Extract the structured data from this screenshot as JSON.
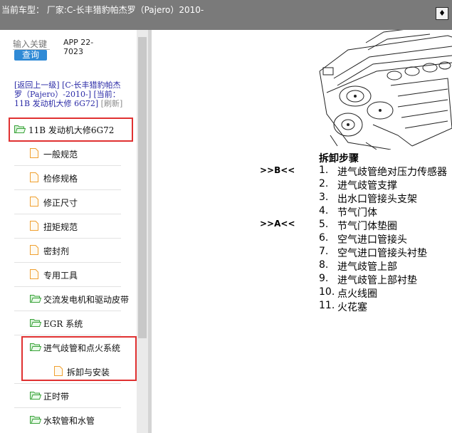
{
  "header": {
    "title": "当前车型： 厂家:C-长丰猎豹帕杰罗（Pajero）2010-",
    "close_glyph": "♦"
  },
  "search": {
    "placeholder": "输入关键",
    "button_label": "查询"
  },
  "app_id": "APP 22-7023",
  "breadcrumb": {
    "back_text": "[返回上一级] [C-长丰猎豹帕杰罗（Pajero）-2010-]",
    "current_text": "[当前：11B 发动机大修 6G72]",
    "refresh_text": "[刷新]"
  },
  "tree": {
    "root": "11B 发动机大修6G72",
    "items": [
      "一般规范",
      "检修规格",
      "修正尺寸",
      "扭矩规范",
      "密封剂",
      "专用工具",
      "交流发电机和驱动皮带",
      "EGR 系统",
      "进气歧管和点火系统",
      "拆卸与安装",
      "正时带",
      "水软管和水管"
    ]
  },
  "doc": {
    "steps_title": "拆卸步骤",
    "markers": [
      ">>B<<",
      ">>A<<"
    ],
    "steps": [
      {
        "num": "1.",
        "text": "进气歧管绝对压力传感器"
      },
      {
        "num": "2.",
        "text": "进气歧管支撑"
      },
      {
        "num": "3.",
        "text": "出水口管接头支架"
      },
      {
        "num": "4.",
        "text": "节气门体"
      },
      {
        "num": "5.",
        "text": "节气门体垫圈"
      },
      {
        "num": "6.",
        "text": "空气进口管接头"
      },
      {
        "num": "7.",
        "text": "空气进口管接头衬垫"
      },
      {
        "num": "8.",
        "text": "进气歧管上部"
      },
      {
        "num": "9.",
        "text": "进气歧管上部衬垫"
      },
      {
        "num": "10.",
        "text": "点火线圈"
      },
      {
        "num": "11.",
        "text": "火花塞"
      }
    ]
  },
  "colors": {
    "highlight": "#e03131",
    "link": "#2a2aa6",
    "button": "#2f8ad6",
    "folder": "#3aa33a",
    "file": "#f0a030"
  }
}
